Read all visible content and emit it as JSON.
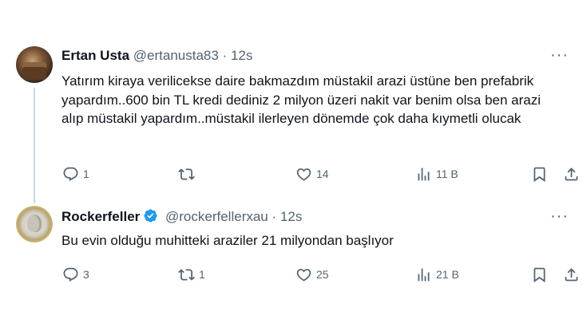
{
  "tweets": [
    {
      "name": "Ertan Usta",
      "handle": "@ertanusta83",
      "separator": "·",
      "time": "12s",
      "text": "Yatırım kiraya verilicekse daire bakmazdım müstakil arazi üstüne ben prefabrik yapardım..600 bin TL kredi dediniz 2 milyon üzeri nakit var benim olsa ben arazi alıp müstakil yapardım..müstakil ilerleyen dönemde çok daha kıymetli olucak",
      "replies": "1",
      "retweets": "",
      "likes": "14",
      "views": "11 B"
    },
    {
      "name": "Rockerfeller",
      "handle": "@rockerfellerxau",
      "separator": "·",
      "time": "12s",
      "verified": true,
      "text": "Bu evin olduğu muhitteki araziler 21 milyondan başlıyor",
      "replies": "3",
      "retweets": "1",
      "likes": "25",
      "views": "21 B"
    }
  ],
  "more_label": "···",
  "icons": {
    "reply": "reply-icon",
    "retweet": "retweet-icon",
    "like": "heart-icon",
    "views": "views-icon",
    "bookmark": "bookmark-icon",
    "share": "share-icon",
    "verified": "verified-badge-icon"
  },
  "colors": {
    "verified": "#1d9bf0",
    "text": "#0f1419",
    "muted": "#536471"
  }
}
